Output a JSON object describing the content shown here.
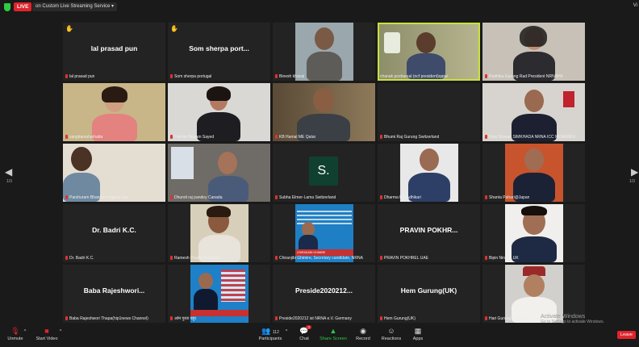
{
  "topbar": {
    "live_label": "LIVE",
    "streaming_label": "on Custom Live Streaming Service",
    "view_label": "Vi"
  },
  "pagination": {
    "left_page": "1/3",
    "right_page": "1/3"
  },
  "participants": [
    {
      "caption": "lal prasad pun",
      "display": "lal prasad pun"
    },
    {
      "caption": "Som sherpa portugal",
      "display": "Som sherpa port..."
    },
    {
      "caption": "Binesh khanal",
      "display": ""
    },
    {
      "caption": "chanak poshareal (ncf president)qatar",
      "display": ""
    },
    {
      "caption": "Radhika Gurung Rad President NRNAHK",
      "display": ""
    },
    {
      "caption": "sangitamaharhatta",
      "display": ""
    },
    {
      "caption": "Yasmin Begam Sayed",
      "display": ""
    },
    {
      "caption": "KB Hamal ME Qatar",
      "display": ""
    },
    {
      "caption": "Bhumi Raj Gurung Switzerland",
      "display": ""
    },
    {
      "caption": "Ram Sharan SIMKHADA NRNA ICC MEMEBER",
      "display": ""
    },
    {
      "caption": "Parshuram Bhandari virginia usa",
      "display": ""
    },
    {
      "caption": "Dhundi raj pandey Canada",
      "display": ""
    },
    {
      "caption": "Subha Elmer-Lama Switzerland",
      "display": "S."
    },
    {
      "caption": "Dharma Raj Adhikari",
      "display": ""
    },
    {
      "caption": "Shanta Pahari@Japan",
      "display": ""
    },
    {
      "caption": "Dr. Badri K.C.",
      "display": "Dr. Badri K.C."
    },
    {
      "caption": "Ramesh Poudel Australia",
      "display": ""
    },
    {
      "caption": "Chiranjibi Ghimire, Secretary candidate, NRNA",
      "display": ""
    },
    {
      "caption": "PRAVIN POKHREL UAE",
      "display": "PRAVIN POKHR..."
    },
    {
      "caption": "Bipin Niraula UK",
      "display": ""
    },
    {
      "caption": "Baba Rajeshwori Thapa(hip1news Channel)",
      "display": "Baba Rajeshwori..."
    },
    {
      "caption": "ओम गुरुङ बहुर",
      "display": ""
    },
    {
      "caption": "Preside2020212 ist NRNA e.V. Germany",
      "display": "Preside2020212..."
    },
    {
      "caption": "Hem Gurung(UK)",
      "display": "Hem Gurung(UK)"
    },
    {
      "caption": "Hari Gurung UK (Gurkha Task Force)",
      "display": ""
    }
  ],
  "poster_text": {
    "candidate_name": "CHIRANJIBI GHIMIRE"
  },
  "toolbar": {
    "unmute": "Unmute",
    "start_video": "Start Video",
    "participants": "Participants",
    "participants_count": "112",
    "chat": "Chat",
    "chat_badge": "3",
    "share_screen": "Share Screen",
    "record": "Record",
    "reactions": "Reactions",
    "apps": "Apps",
    "leave": "Leave"
  },
  "watermark": {
    "title": "Activate Windows",
    "subtitle": "Go to Settings to activate Windows."
  },
  "colors": {
    "accent": "#c9e23c",
    "live": "#e0242c",
    "share": "#2ecc40"
  }
}
